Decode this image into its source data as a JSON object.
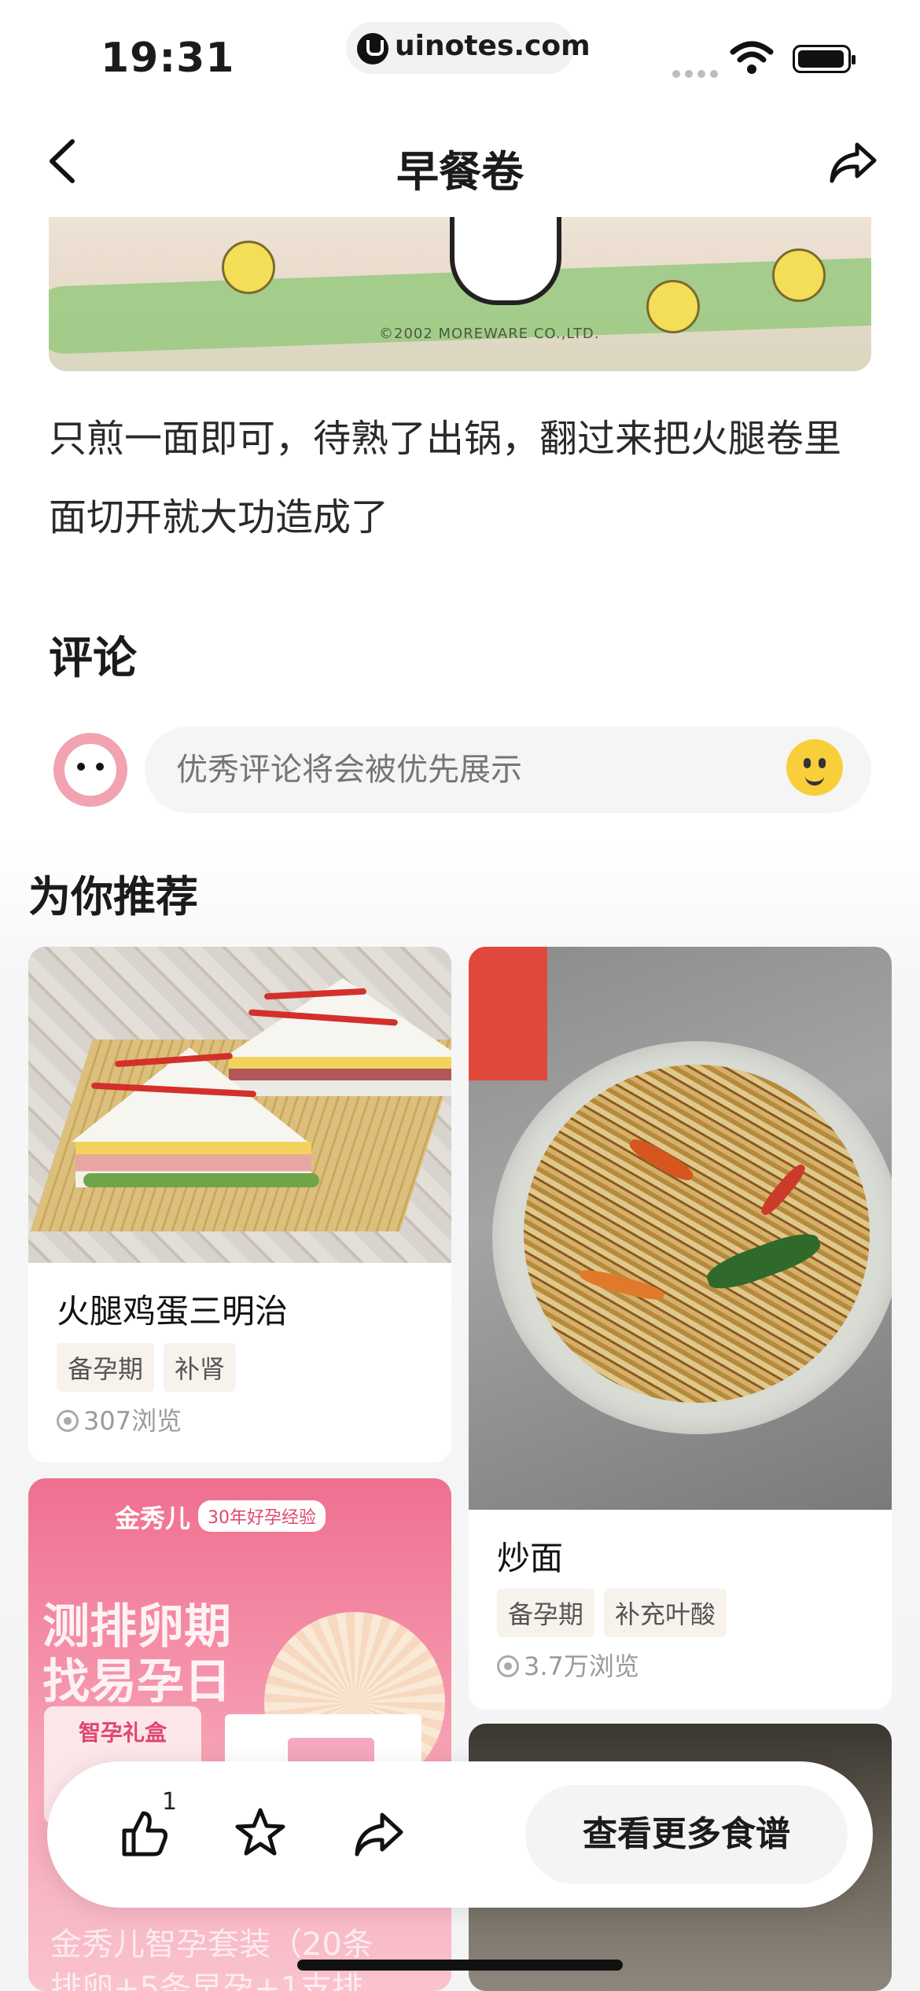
{
  "status_bar": {
    "time": "19:31",
    "url": "uinotes.com"
  },
  "nav": {
    "title": "早餐卷"
  },
  "recipe": {
    "step_text_line1": "只煎一面即可，待熟了出锅，翻过来把火腿卷里",
    "step_text_line2": "面切开就大功造成了"
  },
  "hero": {
    "copyright": "©2002 MOREWARE CO.,LTD."
  },
  "comments": {
    "heading": "评论",
    "placeholder": "优秀评论将会被优先展示"
  },
  "recommend": {
    "heading": "为你推荐",
    "cards": [
      {
        "title": "火腿鸡蛋三明治",
        "tags": [
          "备孕期",
          "补肾"
        ],
        "views": "307浏览"
      },
      {
        "title": "炒面",
        "tags": [
          "备孕期",
          "补充叶酸"
        ],
        "views": "3.7万浏览"
      },
      {
        "brand": "金秀儿",
        "badge": "30年好孕经验",
        "headline1": "测排卵期",
        "headline2": "找易孕日",
        "box_label": "智孕礼盒",
        "title_partial": "金秀儿智孕套装（20条",
        "subtitle_partial": "排卵+5条早孕+1支排"
      }
    ]
  },
  "bottom_bar": {
    "like_count": "1",
    "more_button": "查看更多食谱"
  }
}
